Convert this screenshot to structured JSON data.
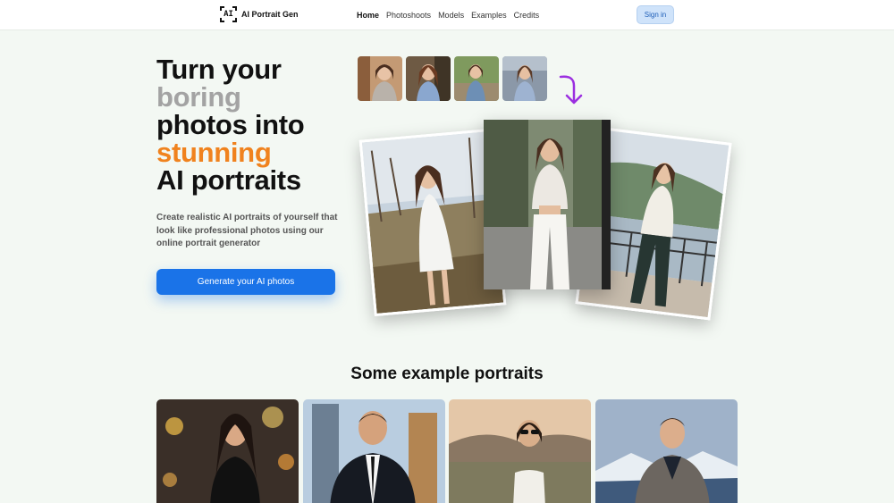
{
  "nav": {
    "logo_mark": "AI",
    "logo_text": "AI Portrait Gen",
    "items": [
      "Home",
      "Photoshoots",
      "Models",
      "Examples",
      "Credits"
    ],
    "signin": "Sign in"
  },
  "hero": {
    "headline": [
      "Turn your",
      "boring",
      "photos into",
      "stunning",
      "AI portraits"
    ],
    "subtext": "Create realistic AI portraits of yourself that look like professional photos using our online portrait generator",
    "cta": "Generate your AI photos"
  },
  "examples": {
    "title": "Some example portraits"
  },
  "colors": {
    "accent": "#1a73e8",
    "orange": "#f0821e",
    "grey_text": "#a3a3a3",
    "arrow": "#9b2fe0",
    "background": "#f3f8f3"
  }
}
